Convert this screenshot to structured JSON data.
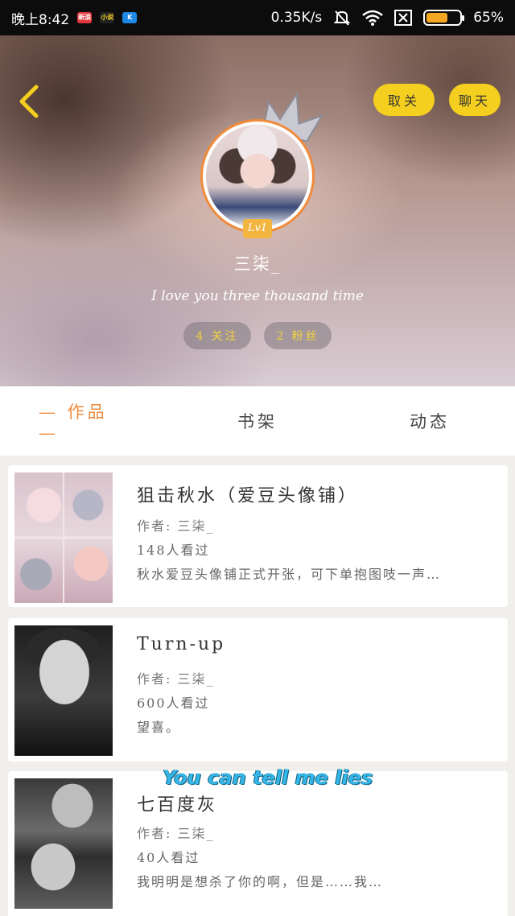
{
  "status_bar": {
    "time": "晚上8:42",
    "app_badges": [
      "新浪",
      "小说",
      "K"
    ],
    "network_speed": "0.35K/s",
    "battery_percent": "65%",
    "battery_level": 0.65,
    "icons": [
      "mute-bell-icon",
      "wifi-icon",
      "sim-off-icon",
      "battery-icon"
    ]
  },
  "header": {
    "back_icon": "chevron-left-icon",
    "unfollow_label": "取关",
    "chat_label": "聊天",
    "level": "Lv1",
    "username": "三柒_",
    "bio": "I love you three thousand time",
    "following": "4 关注",
    "fans": "2 粉丝",
    "accent_color": "#f5cf1f"
  },
  "tabs": [
    {
      "label": "— 作品 —",
      "active": true
    },
    {
      "label": "书架",
      "active": false
    },
    {
      "label": "动态",
      "active": false
    }
  ],
  "works": [
    {
      "title": "狙击秋水（爱豆头像铺）",
      "author": "作者: 三柒_",
      "views": "148人看过",
      "summary": "秋水爱豆头像铺正式开张，可下单抱图吱一声…"
    },
    {
      "title": "Turn-up",
      "author": "作者: 三柒_",
      "views": "600人看过",
      "summary": "望喜。"
    },
    {
      "title": "七百度灰",
      "author": "作者: 三柒_",
      "views": "40人看过",
      "summary": "我明明是想杀了你的啊，但是……我…"
    }
  ],
  "watermark_text": "You can tell me lies"
}
